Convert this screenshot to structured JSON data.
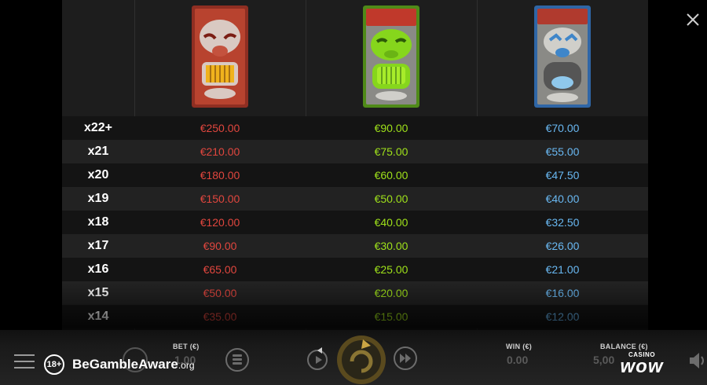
{
  "paytable": {
    "symbols": [
      {
        "name": "red-tiki-mask",
        "color": "#b33a2a"
      },
      {
        "name": "green-tiki-mask",
        "color": "#7ab61e"
      },
      {
        "name": "blue-tiki-mask",
        "color": "#3f86c9"
      }
    ],
    "rows": [
      {
        "mult": "x22+",
        "v1": "€250.00",
        "v2": "€90.00",
        "v3": "€70.00"
      },
      {
        "mult": "x21",
        "v1": "€210.00",
        "v2": "€75.00",
        "v3": "€55.00"
      },
      {
        "mult": "x20",
        "v1": "€180.00",
        "v2": "€60.00",
        "v3": "€47.50"
      },
      {
        "mult": "x19",
        "v1": "€150.00",
        "v2": "€50.00",
        "v3": "€40.00"
      },
      {
        "mult": "x18",
        "v1": "€120.00",
        "v2": "€40.00",
        "v3": "€32.50"
      },
      {
        "mult": "x17",
        "v1": "€90.00",
        "v2": "€30.00",
        "v3": "€26.00"
      },
      {
        "mult": "x16",
        "v1": "€65.00",
        "v2": "€25.00",
        "v3": "€21.00"
      },
      {
        "mult": "x15",
        "v1": "€50.00",
        "v2": "€20.00",
        "v3": "€16.00"
      },
      {
        "mult": "x14",
        "v1": "€35.00",
        "v2": "€15.00",
        "v3": "€12.00"
      }
    ]
  },
  "controls": {
    "bet_label": "BET (€)",
    "bet_value": "1.00",
    "win_label": "WIN (€)",
    "win_value": "0.00",
    "balance_label": "BALANCE (€)",
    "balance_value": "5,00"
  },
  "footer": {
    "age_badge": "18+",
    "gamble_aware_text": "BeGambleAware",
    "gamble_aware_suffix": ".org",
    "brand_small": "CASINO",
    "brand_big": "wow"
  },
  "icons": [
    "close-icon",
    "menu-icon",
    "coin-stack-icon",
    "autoplay-icon",
    "spin-icon",
    "turbo-icon",
    "sound-icon"
  ]
}
